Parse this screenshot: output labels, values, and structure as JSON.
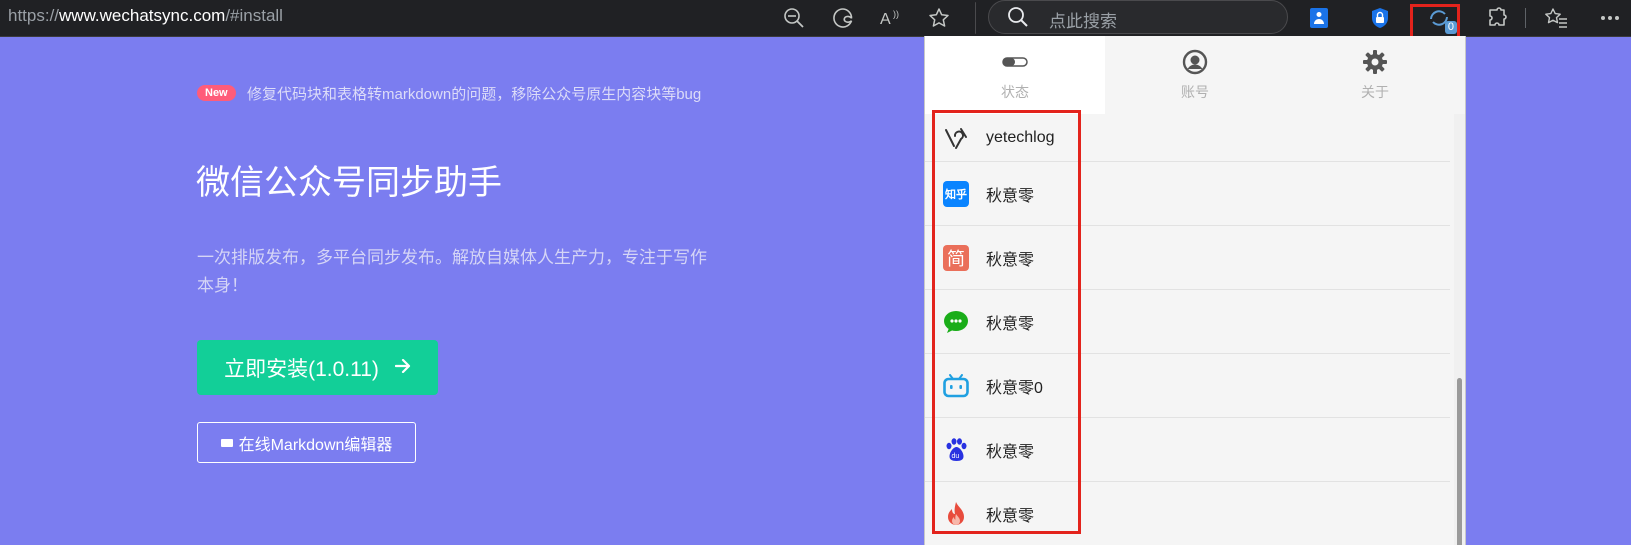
{
  "browser": {
    "url_scheme": "https://",
    "url_host": "www.wechatsync.com",
    "url_path": "/#install",
    "search_placeholder": "点此搜索",
    "extension_badge": "0"
  },
  "hero": {
    "new_badge": "New",
    "notice": "修复代码块和表格转markdown的问题，移除公众号原生内容块等bug",
    "title": "微信公众号同步助手",
    "description": "一次排版发布，多平台同步发布。解放自媒体人生产力，专注于写作本身！",
    "install_label": "立即安装(1.0.11)",
    "editor_label": "在线Markdown编辑器"
  },
  "popup": {
    "tabs": [
      {
        "label": "状态",
        "icon": "toggle-icon"
      },
      {
        "label": "账号",
        "icon": "account-icon"
      },
      {
        "label": "关于",
        "icon": "gear-icon"
      }
    ],
    "accounts": [
      {
        "name": "yetechlog",
        "icon": "yetechlog-logo"
      },
      {
        "name": "秋意零",
        "icon": "zhihu-logo",
        "icon_text": "知乎"
      },
      {
        "name": "秋意零",
        "icon": "jianshu-logo",
        "icon_text": "简"
      },
      {
        "name": "秋意零",
        "icon": "wechat-logo"
      },
      {
        "name": "秋意零0",
        "icon": "bilibili-logo"
      },
      {
        "name": "秋意零",
        "icon": "baidu-logo"
      },
      {
        "name": "秋意零",
        "icon": "flame-logo"
      }
    ]
  },
  "colors": {
    "hero_bg": "#7b7df0",
    "install_green": "#12cf98",
    "highlight_red": "#e3231c",
    "zhihu_blue": "#0a84ff",
    "jianshu_red": "#ea6f5a",
    "wechat_green": "#1aad19",
    "bilibili_blue": "#20a0e1",
    "baidu_blue": "#2932e1"
  }
}
